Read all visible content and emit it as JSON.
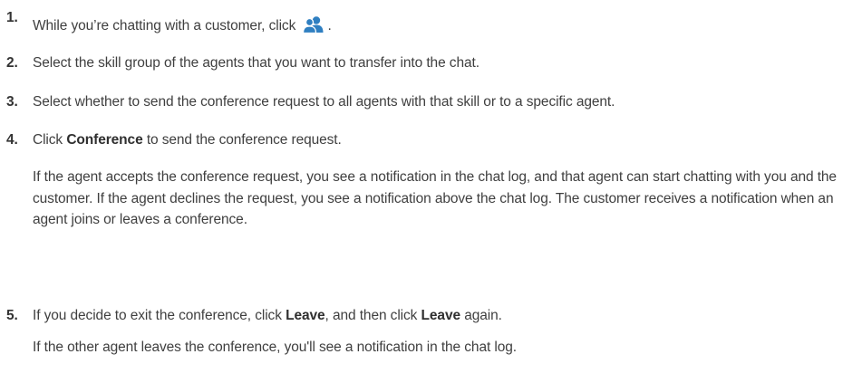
{
  "steps": [
    {
      "number": "1.",
      "text_before": "While you’re chatting with a customer, click",
      "icon": "conference-agents-icon",
      "text_after": "."
    },
    {
      "number": "2.",
      "text": "Select the skill group of the agents that you want to transfer into the chat."
    },
    {
      "number": "3.",
      "text": "Select whether to send the conference request to all agents with that skill or to a specific agent."
    },
    {
      "number": "4.",
      "text_before": "Click",
      "bold": "Conference",
      "text_after": "to send the conference request.",
      "note": "If the agent accepts the conference request, you see a notification in the chat log, and that agent can start chatting with you and the customer. If the agent declines the request, you see a notification above the chat log. The customer receives a notification when an agent joins or leaves a conference."
    },
    {
      "number": "5.",
      "text_before": "If you decide to exit the conference, click",
      "bold1": "Leave",
      "text_middle": ", and then click",
      "bold2": "Leave",
      "text_after": "again.",
      "note": "If the other agent leaves the conference, you'll see a notification in the chat log."
    }
  ],
  "colors": {
    "icon": "#2f7fc1",
    "text": "#3f3f3f"
  }
}
